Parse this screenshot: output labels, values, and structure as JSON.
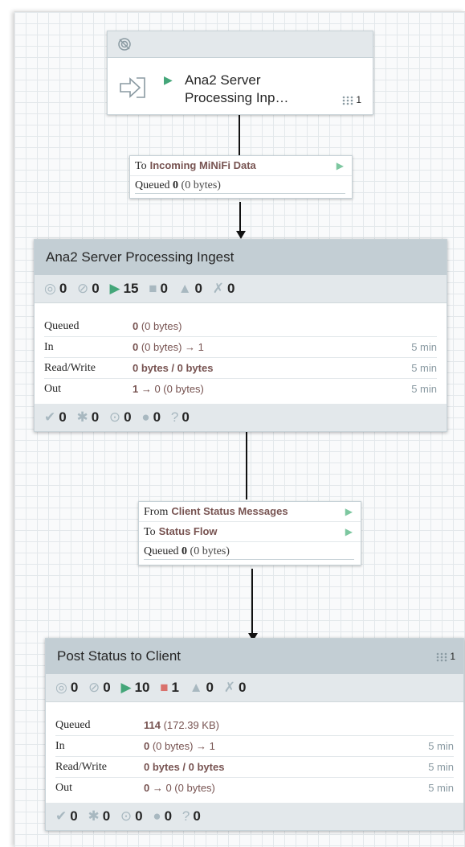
{
  "remote_port": {
    "name_line1": "Ana2 Server",
    "name_line2": "Processing Inp…",
    "count": "1",
    "play_glyph": "▶"
  },
  "connection1": {
    "to_prefix": "To",
    "to_name": "Incoming MiNiFi Data",
    "queued_label": "Queued",
    "queued_value": "0",
    "queued_sub": "(0 bytes)"
  },
  "group1": {
    "title": "Ana2 Server Processing Ingest",
    "stats": {
      "transmitting": "0",
      "not_transmitting": "0",
      "running": "15",
      "stopped": "0",
      "invalid": "0",
      "disabled": "0"
    },
    "rows": [
      {
        "label": "Queued",
        "val_bold": "0",
        "val_rest": " (0 bytes)",
        "time": ""
      },
      {
        "label": "In",
        "val_bold": "0",
        "val_rest": " (0 bytes) → 1",
        "time": "5 min"
      },
      {
        "label": "Read/Write",
        "val_bold": "0 bytes / 0 bytes",
        "val_rest": "",
        "time": "5 min"
      },
      {
        "label": "Out",
        "val_bold": "1",
        "val_rest": " → 0 (0 bytes)",
        "time": "5 min"
      }
    ],
    "versions": {
      "up_to_date": "0",
      "locally_modified": "0",
      "stale": "0",
      "stale_modified": "0",
      "sync_failure": "0"
    }
  },
  "connection2": {
    "from_prefix": "From",
    "from_name": "Client Status Messages",
    "to_prefix": "To",
    "to_name": "Status Flow",
    "queued_label": "Queued",
    "queued_value": "0",
    "queued_sub": "(0 bytes)"
  },
  "group2": {
    "title": "Post Status to Client",
    "count": "1",
    "stats": {
      "transmitting": "0",
      "not_transmitting": "0",
      "running": "10",
      "stopped": "1",
      "invalid": "0",
      "disabled": "0"
    },
    "rows": [
      {
        "label": "Queued",
        "val_bold": "114",
        "val_rest": " (172.39 KB)",
        "time": ""
      },
      {
        "label": "In",
        "val_bold": "0",
        "val_rest": " (0 bytes) → 1",
        "time": "5 min"
      },
      {
        "label": "Read/Write",
        "val_bold": "0 bytes / 0 bytes",
        "val_rest": "",
        "time": "5 min"
      },
      {
        "label": "Out",
        "val_bold": "0",
        "val_rest": " → 0 (0 bytes)",
        "time": "5 min"
      }
    ],
    "versions": {
      "up_to_date": "0",
      "locally_modified": "0",
      "stale": "0",
      "stale_modified": "0",
      "sync_failure": "0"
    }
  },
  "colors": {
    "running": "#44a679",
    "stopped": "#d9716c",
    "title_bar": "#c3ced4",
    "name_text": "#775351"
  }
}
